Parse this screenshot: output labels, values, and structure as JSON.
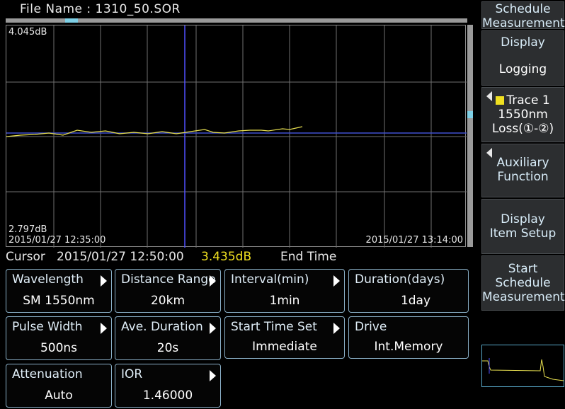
{
  "header": {
    "file_label": "File Name : 1310_50.SOR"
  },
  "plot": {
    "y_max_label": "4.045dB",
    "y_min_label": "2.797dB",
    "x_start_label": "2015/01/27 12:35:00",
    "x_end_label": "2015/01/27 13:14:00",
    "trace_color": "#e8e050",
    "cursor_color": "#5050ff",
    "marker_line_color": "#4050d0",
    "grid_color": "#707070"
  },
  "cursor": {
    "label": "Cursor",
    "time": "2015/01/27 12:50:00",
    "value": "3.435dB",
    "end_label": "End Time"
  },
  "params": {
    "wavelength": {
      "label": "Wavelength",
      "value": "SM 1550nm"
    },
    "distance_range": {
      "label": "Distance Range",
      "value": "20km"
    },
    "interval": {
      "label": "Interval(min)",
      "value": "1min"
    },
    "duration": {
      "label": "Duration(days)",
      "value": "1day"
    },
    "pulse_width": {
      "label": "Pulse Width",
      "value": "500ns"
    },
    "ave_duration": {
      "label": "Ave. Duration",
      "value": "20s"
    },
    "start_time_set": {
      "label": "Start Time Set",
      "value": "Immediate"
    },
    "drive": {
      "label": "Drive",
      "value": "Int.Memory"
    },
    "attenuation": {
      "label": "Attenuation",
      "value": "Auto"
    },
    "ior": {
      "label": "IOR",
      "value": "1.46000"
    }
  },
  "softkeys": {
    "title": {
      "line1": "Schedule",
      "line2": "Measurement"
    },
    "display": {
      "line1": "Display",
      "line2": "Logging"
    },
    "trace": {
      "line1": "Trace 1",
      "line2": "1550nm",
      "line3": "Loss(①-②)",
      "swatch_color": "#f0e020"
    },
    "auxiliary": {
      "line1": "Auxiliary",
      "line2": "Function"
    },
    "display_item": {
      "line1": "Display",
      "line2": "Item Setup"
    },
    "start": {
      "line1": "Start",
      "line2": "Schedule",
      "line3": "Measurement"
    }
  },
  "icons": {
    "param_arrow": "triangle-right-icon",
    "softkey_arrow": "triangle-left-icon"
  }
}
